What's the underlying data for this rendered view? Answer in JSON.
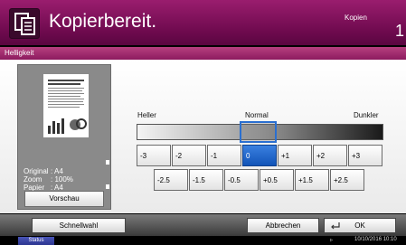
{
  "header": {
    "title": "Kopierbereit.",
    "copies_label": "Kopien",
    "copies_count": "1",
    "app_icon": "copy-icon"
  },
  "section": {
    "title": "Helligkeit"
  },
  "preview": {
    "info": [
      {
        "key": "Original",
        "value": ": A4"
      },
      {
        "key": "Zoom",
        "value": ": 100%"
      },
      {
        "key": "Papier",
        "value": ": A4"
      }
    ],
    "button_label": "Vorschau"
  },
  "slider": {
    "left_label": "Heller",
    "center_label": "Normal",
    "right_label": "Dunkler",
    "selected_value": "0",
    "row1": [
      "-3",
      "-2",
      "-1",
      "0",
      "+1",
      "+2",
      "+3"
    ],
    "row2": [
      "-2.5",
      "-1.5",
      "-0.5",
      "+0.5",
      "+1.5",
      "+2.5"
    ]
  },
  "bottom": {
    "quick_label": "Schnellwahl",
    "cancel_label": "Abbrechen",
    "ok_label": "OK",
    "ok_icon": "enter-icon"
  },
  "status": {
    "label": "Status",
    "datetime": "10/10/2016  10:10"
  },
  "colors": {
    "header": "#7a0f57",
    "section_bar": "#a52f70",
    "selected": "#1f64c9",
    "marker": "#2a6fd0"
  }
}
